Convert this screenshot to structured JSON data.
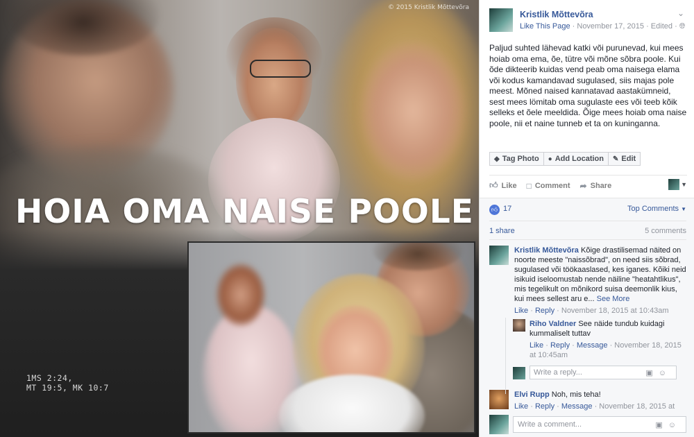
{
  "photo": {
    "copyright": "© 2015 Kristlik Mõttevõra",
    "headline": "HOIA OMA NAISE POOLE",
    "stats_line1": "1MS 2:24,",
    "stats_line2": "MT 19:5, MK 10:7"
  },
  "post": {
    "page_name": "Kristlik Mõttevõra",
    "like_page": "Like This Page",
    "date": "November 17, 2015",
    "edited": "Edited",
    "body": "Paljud suhted lähevad katki või purunevad, kui mees hoiab oma ema, õe, tütre või mõne sõbra poole. Kui õde dikteerib kuidas vend peab oma naisega elama või kodus kamandavad sugulased, siis majas pole meest. Mõned naised kannatavad aastakümneid, sest mees lömitab oma sugulaste ees või teeb kõik selleks et õele meeldida. Õige mees hoiab oma naise poole, nii et naine tunneb et ta on kuninganna.",
    "photo_actions": {
      "tag_photo": "Tag Photo",
      "add_location": "Add Location",
      "edit": "Edit"
    },
    "actions": {
      "like": "Like",
      "comment": "Comment",
      "share": "Share"
    }
  },
  "feedback": {
    "like_count": "17",
    "top_comments": "Top Comments",
    "shares": "1 share",
    "comments": "5 comments"
  },
  "comments": [
    {
      "author": "Kristlik Mõttevõra",
      "text": "Kõige drastilisemad näited on noorte meeste \"naissõbrad\", on need siis sõbrad, sugulased või töökaaslased, kes iganes. Kõiki neid isikuid iseloomustab nende näiline \"heatahtlikus\", mis tegelikult on mõnikord suisa deemonlik kius, kui mees sellest aru e...",
      "see_more": "See More",
      "like": "Like",
      "reply": "Reply",
      "time": "November 18, 2015 at 10:43am"
    },
    {
      "author": "Riho Valdner",
      "text": "See näide tundub kuidagi kummaliselt tuttav",
      "like": "Like",
      "reply": "Reply",
      "message": "Message",
      "time": "November 18, 2015 at 10:45am"
    },
    {
      "author": "Elvi Rupp",
      "text": "Noh, mis teha!",
      "like": "Like",
      "reply": "Reply",
      "message": "Message",
      "time": "November 18, 2015 at"
    }
  ],
  "inputs": {
    "reply_placeholder": "Write a reply...",
    "comment_placeholder": "Write a comment..."
  },
  "icons": [
    "tag-icon",
    "location-pin-icon",
    "pencil-icon",
    "thumbs-up-icon",
    "comment-icon",
    "share-icon",
    "camera-icon",
    "smiley-icon",
    "globe-icon",
    "chevron-down-icon"
  ],
  "colors": {
    "link": "#365899",
    "muted": "#90949c",
    "like_blue": "#4f76d8"
  }
}
